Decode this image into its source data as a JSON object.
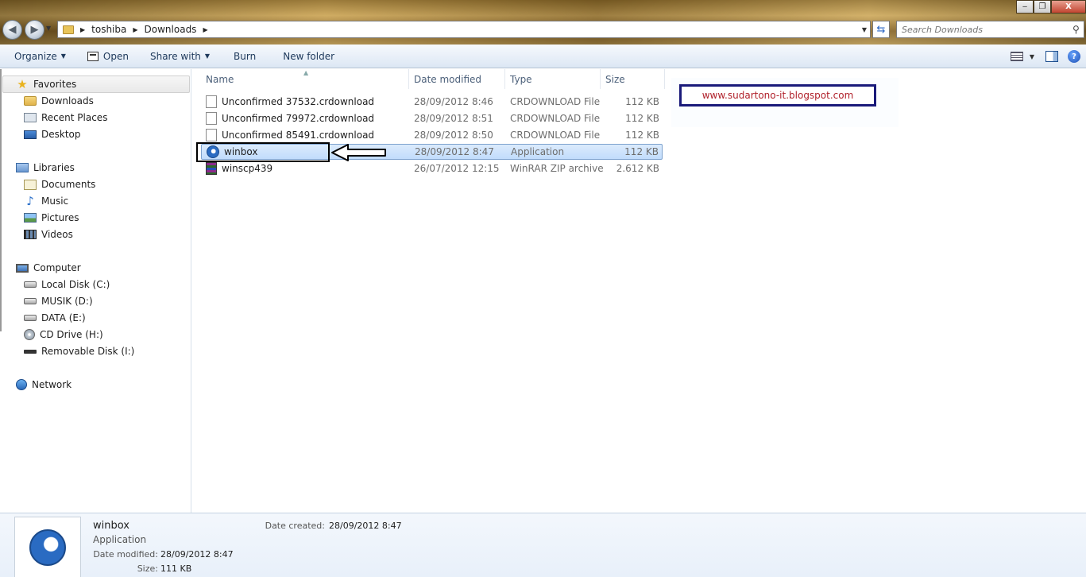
{
  "window": {
    "controls": {
      "minimize": "‒",
      "maximize": "❐",
      "close": "X"
    }
  },
  "address": {
    "crumbs": [
      "toshiba",
      "Downloads"
    ],
    "search_placeholder": "Search Downloads"
  },
  "toolbar": {
    "organize": "Organize",
    "open": "Open",
    "share_with": "Share with",
    "burn": "Burn",
    "new_folder": "New folder"
  },
  "nav": {
    "favorites": "Favorites",
    "downloads": "Downloads",
    "recent_places": "Recent Places",
    "desktop": "Desktop",
    "libraries": "Libraries",
    "documents": "Documents",
    "music": "Music",
    "pictures": "Pictures",
    "videos": "Videos",
    "computer": "Computer",
    "local_disk": "Local Disk (C:)",
    "musik": "MUSIK (D:)",
    "data": "DATA (E:)",
    "cd_drive": "CD Drive (H:)",
    "removable": "Removable Disk (I:)",
    "network": "Network"
  },
  "columns": {
    "name": "Name",
    "date": "Date modified",
    "type": "Type",
    "size": "Size"
  },
  "files": [
    {
      "name": "Unconfirmed 37532.crdownload",
      "date": "28/09/2012 8:46",
      "type": "CRDOWNLOAD File",
      "size": "112 KB"
    },
    {
      "name": "Unconfirmed 79972.crdownload",
      "date": "28/09/2012 8:51",
      "type": "CRDOWNLOAD File",
      "size": "112 KB"
    },
    {
      "name": "Unconfirmed 85491.crdownload",
      "date": "28/09/2012 8:50",
      "type": "CRDOWNLOAD File",
      "size": "112 KB"
    },
    {
      "name": "winbox",
      "date": "28/09/2012 8:47",
      "type": "Application",
      "size": "112 KB"
    },
    {
      "name": "winscp439",
      "date": "26/07/2012 12:15",
      "type": "WinRAR ZIP archive",
      "size": "2.612 KB"
    }
  ],
  "watermark": "www.sudartono-it.blogspot.com",
  "details": {
    "name": "winbox",
    "type": "Application",
    "date_modified_label": "Date modified:",
    "date_modified": "28/09/2012 8:47",
    "size_label": "Size:",
    "size": "111 KB",
    "date_created_label": "Date created:",
    "date_created": "28/09/2012 8:47"
  }
}
